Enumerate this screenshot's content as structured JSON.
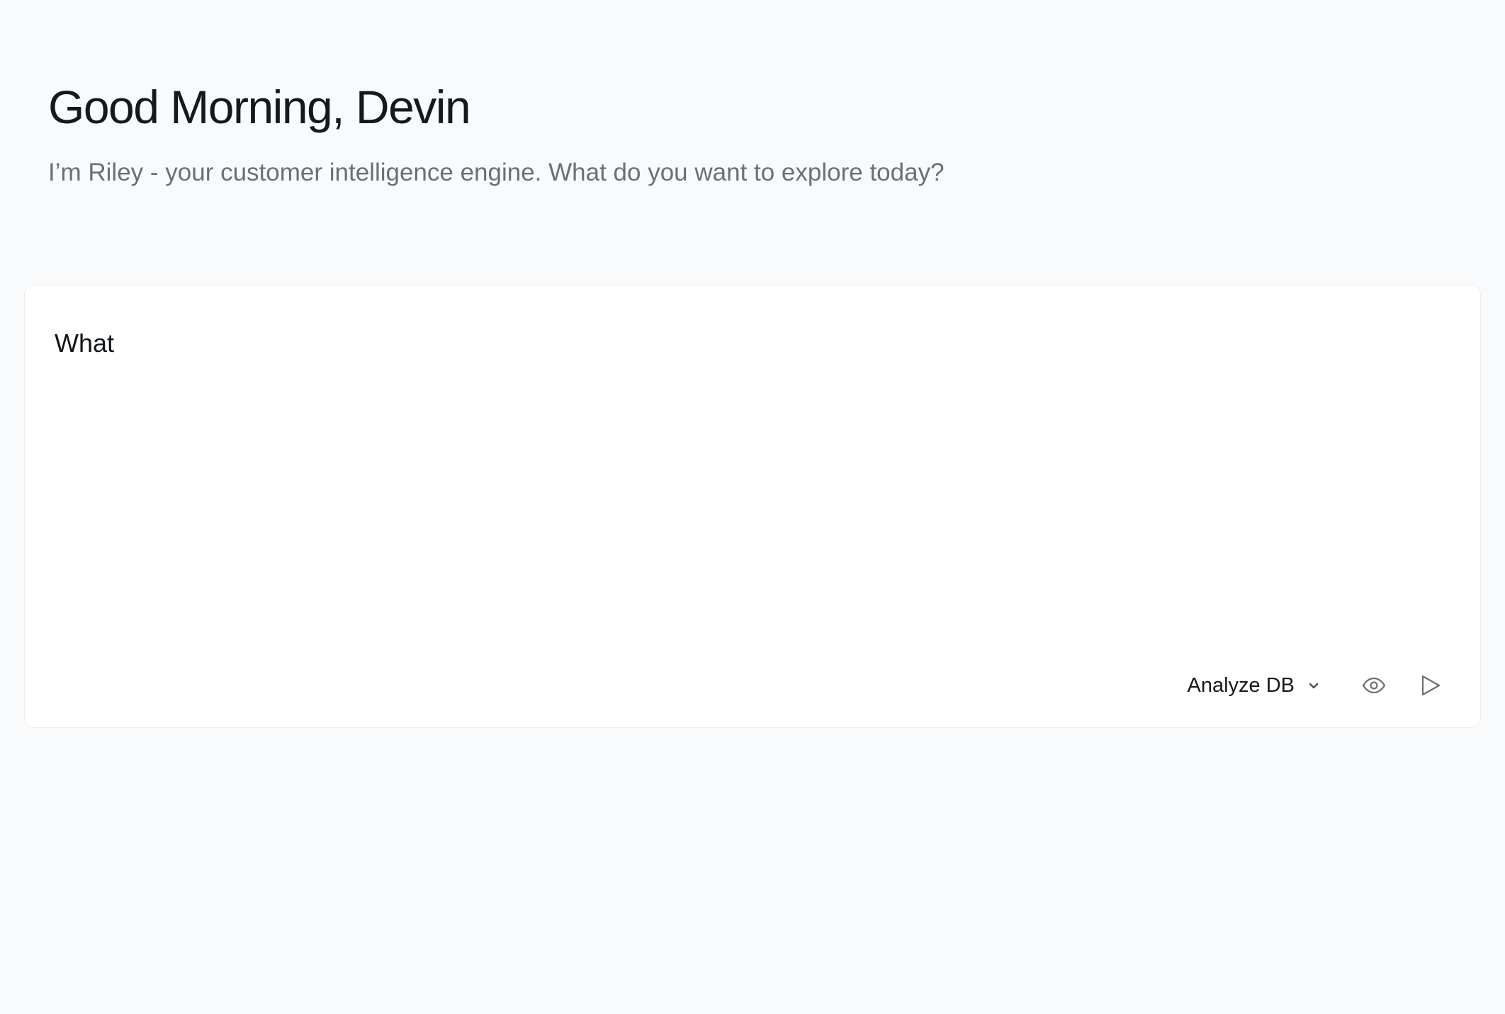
{
  "header": {
    "greeting": "Good Morning, Devin",
    "subtitle": "I’m Riley - your customer intelligence engine. What do you want to explore today?"
  },
  "composer": {
    "input_value": "What",
    "mode": {
      "selected": "Analyze DB",
      "icon": "chevron-down-icon"
    },
    "preview_icon": "eye-icon",
    "send_icon": "send-icon"
  },
  "colors": {
    "page_background": "#f9fafb",
    "card_background": "#ffffff",
    "heading_text": "#15191e",
    "muted_text": "#6b6f76",
    "icon_gray": "#6b6f76"
  }
}
